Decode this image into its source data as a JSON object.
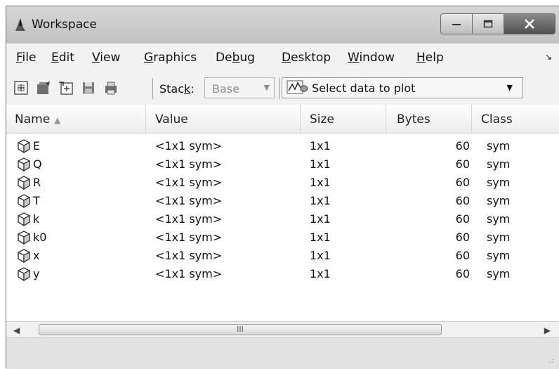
{
  "window": {
    "title": "Workspace"
  },
  "menu": {
    "file": "File",
    "edit": "Edit",
    "view": "View",
    "graphics": "Graphics",
    "debug": "Debug",
    "desktop": "Desktop",
    "window": "Window",
    "help": "Help"
  },
  "toolbar": {
    "stack_label": "Stack:",
    "stack_value": "Base",
    "plot_label": "Select data to plot"
  },
  "columns": {
    "name": "Name",
    "value": "Value",
    "size": "Size",
    "bytes": "Bytes",
    "class": "Class"
  },
  "variables": [
    {
      "name": "E",
      "value": "<1x1 sym>",
      "size": "1x1",
      "bytes": "60",
      "class": "sym"
    },
    {
      "name": "Q",
      "value": "<1x1 sym>",
      "size": "1x1",
      "bytes": "60",
      "class": "sym"
    },
    {
      "name": "R",
      "value": "<1x1 sym>",
      "size": "1x1",
      "bytes": "60",
      "class": "sym"
    },
    {
      "name": "T",
      "value": "<1x1 sym>",
      "size": "1x1",
      "bytes": "60",
      "class": "sym"
    },
    {
      "name": "k",
      "value": "<1x1 sym>",
      "size": "1x1",
      "bytes": "60",
      "class": "sym"
    },
    {
      "name": "k0",
      "value": "<1x1 sym>",
      "size": "1x1",
      "bytes": "60",
      "class": "sym"
    },
    {
      "name": "x",
      "value": "<1x1 sym>",
      "size": "1x1",
      "bytes": "60",
      "class": "sym"
    },
    {
      "name": "y",
      "value": "<1x1 sym>",
      "size": "1x1",
      "bytes": "60",
      "class": "sym"
    }
  ],
  "scrollbar": {
    "grip": "III"
  },
  "icons": {
    "title": "workspace-icon",
    "minimize": "minimize-icon",
    "maximize": "maximize-icon",
    "close": "close-icon",
    "variable": "sym-cube-icon",
    "plot": "plot-icon"
  }
}
